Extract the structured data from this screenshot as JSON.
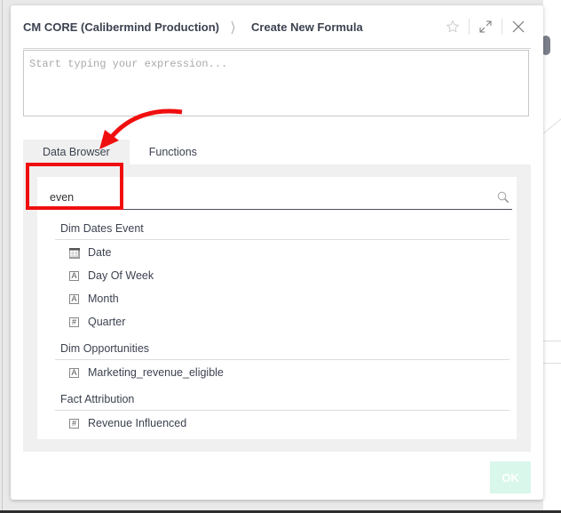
{
  "header": {
    "breadcrumb": [
      "CM CORE (Calibermind Production)",
      "Create New Formula"
    ],
    "separator": "〉",
    "icons": [
      "star-icon",
      "expand-icon",
      "close-icon"
    ]
  },
  "expression": {
    "value": "",
    "placeholder": "Start typing your expression..."
  },
  "tabs": [
    {
      "label": "Data Browser",
      "active": true
    },
    {
      "label": "Functions",
      "active": false
    }
  ],
  "search": {
    "value": "even",
    "icon": "search-icon"
  },
  "groups": [
    {
      "title": "Dim Dates Event",
      "fields": [
        {
          "label": "Date",
          "type": "date",
          "icon": "calendar-icon"
        },
        {
          "label": "Day Of Week",
          "type": "text",
          "glyph": "A"
        },
        {
          "label": "Month",
          "type": "text",
          "glyph": "A"
        },
        {
          "label": "Quarter",
          "type": "number",
          "glyph": "#"
        }
      ]
    },
    {
      "title": "Dim Opportunities",
      "fields": [
        {
          "label": "Marketing_revenue_eligible",
          "type": "text",
          "glyph": "A"
        }
      ]
    },
    {
      "title": "Fact Attribution",
      "fields": [
        {
          "label": "Revenue Influenced",
          "type": "number",
          "glyph": "#"
        }
      ]
    }
  ],
  "footer": {
    "ok_label": "OK"
  },
  "annotation": {
    "color": "#f00f0f",
    "type": "arrow-and-box"
  }
}
